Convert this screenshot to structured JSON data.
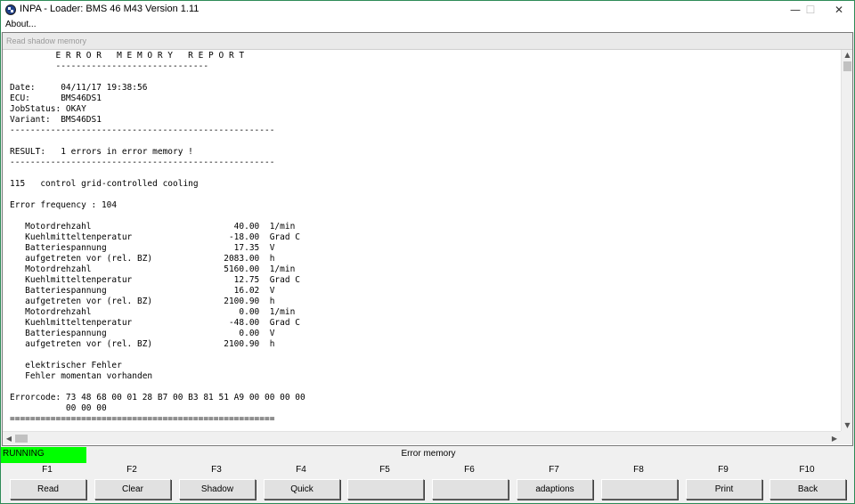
{
  "window": {
    "title": "INPA - Loader:  BMS 46 M43 Version 1.11",
    "minimize_glyph": "—",
    "maximize_glyph": "☐",
    "close_glyph": "✕",
    "icon": "bmw-roundel-icon"
  },
  "menu": {
    "about": "About..."
  },
  "child_window": {
    "title": "Read shadow memory"
  },
  "report": {
    "lines": [
      "         E R R O R   M E M O R Y   R E P O R T",
      "         ------------------------------",
      "",
      "Date:     04/11/17 19:38:56",
      "ECU:      BMS46DS1",
      "JobStatus: OKAY",
      "Variant:  BMS46DS1",
      "----------------------------------------------------",
      "",
      "RESULT:   1 errors in error memory !",
      "----------------------------------------------------",
      "",
      "115   control grid-controlled cooling",
      "",
      "Error frequency : 104",
      "",
      "   Motordrehzahl                            40.00  1/min",
      "   Kuehlmitteltenperatur                   -18.00  Grad C",
      "   Batteriespannung                         17.35  V",
      "   aufgetreten vor (rel. BZ)              2083.00  h",
      "   Motordrehzahl                          5160.00  1/min",
      "   Kuehlmitteltenperatur                    12.75  Grad C",
      "   Batteriespannung                         16.02  V",
      "   aufgetreten vor (rel. BZ)              2100.90  h",
      "   Motordrehzahl                             0.00  1/min",
      "   Kuehlmitteltenperatur                   -48.00  Grad C",
      "   Batteriespannung                          0.00  V",
      "   aufgetreten vor (rel. BZ)              2100.90  h",
      "",
      "   elektrischer Fehler",
      "   Fehler momentan vorhanden",
      "",
      "Errorcode: 73 48 68 00 01 28 B7 00 B3 81 51 A9 00 00 00 00",
      "           00 00 00",
      "===================================================="
    ]
  },
  "scrollbars": {
    "up": "▲",
    "down": "▼",
    "left": "◀",
    "right": "▶"
  },
  "status": {
    "running": "RUNNING",
    "title": "Error memory",
    "running_color": "#00ff00"
  },
  "fkeys": [
    {
      "key": "F1",
      "label": "Read"
    },
    {
      "key": "F2",
      "label": "Clear"
    },
    {
      "key": "F3",
      "label": "Shadow"
    },
    {
      "key": "F4",
      "label": "Quick"
    },
    {
      "key": "F5",
      "label": ""
    },
    {
      "key": "F6",
      "label": ""
    },
    {
      "key": "F7",
      "label": "adaptions"
    },
    {
      "key": "F8",
      "label": ""
    },
    {
      "key": "F9",
      "label": "Print"
    },
    {
      "key": "F10",
      "label": "Back"
    }
  ]
}
